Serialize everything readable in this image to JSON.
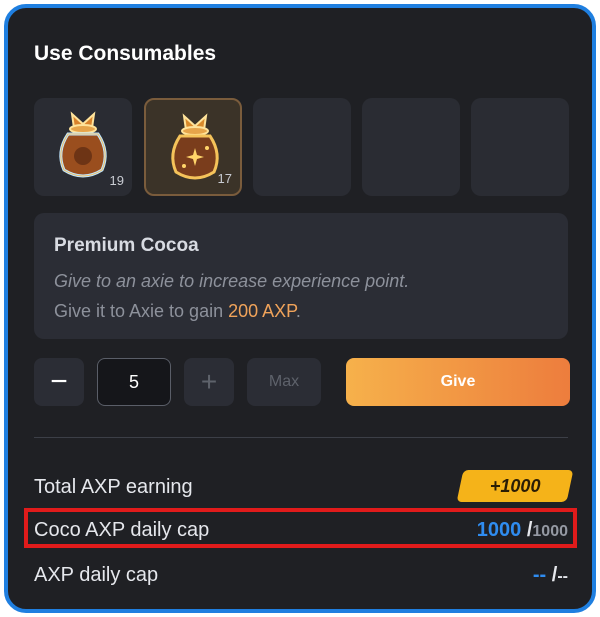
{
  "title": "Use Consumables",
  "slots": [
    {
      "count": "19",
      "icon": "cocoa-bag-icon"
    },
    {
      "count": "17",
      "icon": "premium-cocoa-bag-icon"
    },
    {
      "count": ""
    },
    {
      "count": ""
    },
    {
      "count": ""
    }
  ],
  "item": {
    "name": "Premium Cocoa",
    "description": "Give to an axie to increase experience point.",
    "gain_prefix": "Give it to Axie to gain ",
    "gain_amount": "200 AXP",
    "gain_suffix": "."
  },
  "controls": {
    "minus": "−",
    "quantity": "5",
    "plus": "+",
    "max": "Max",
    "give": "Give"
  },
  "stats": {
    "total_label": "Total AXP earning",
    "total_value": "+1000",
    "coco_label": "Coco AXP daily cap",
    "coco_current": "1000",
    "coco_sep": " /",
    "coco_max": "1000",
    "axp_label": "AXP daily cap",
    "axp_current": "--",
    "axp_sep": " /",
    "axp_max": "--"
  },
  "colors": {
    "frame_border": "#1f7fe0",
    "accent_orange": "#f0a35a",
    "cap_blue": "#2f8cf0",
    "badge_yellow": "#f5b319",
    "highlight_red": "#e01b1b"
  }
}
